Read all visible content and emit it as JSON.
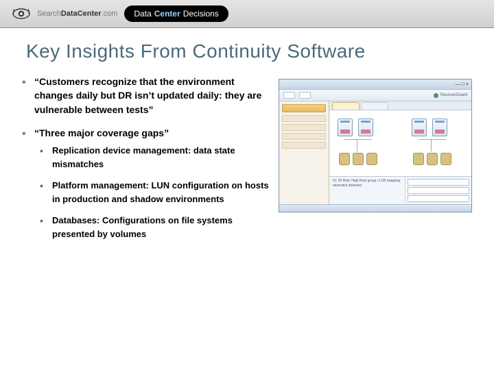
{
  "header": {
    "brand_prefix": "Search",
    "brand_main": "DataCenter",
    "brand_suffix": ".com",
    "pill_word1": "Data",
    "pill_word2": "Center",
    "pill_word3": "Decisions"
  },
  "title": "Key Insights From Continuity Software",
  "bullets": [
    {
      "text": "“Customers recognize that the environment changes daily but DR isn’t updated daily:  they are vulnerable between tests”"
    },
    {
      "text": "“Three major coverage gaps”",
      "sub": [
        "Replication device management: data state mismatches",
        "Platform management: LUN configuration on hosts in production and shadow environments",
        "Databases: Configurations on file systems presented by volumes"
      ]
    }
  ],
  "screenshot": {
    "product": "RecoverGuard",
    "info_lines": "ID: 26   Risk: High\nHost group / LUN mapping mismatch detected"
  }
}
